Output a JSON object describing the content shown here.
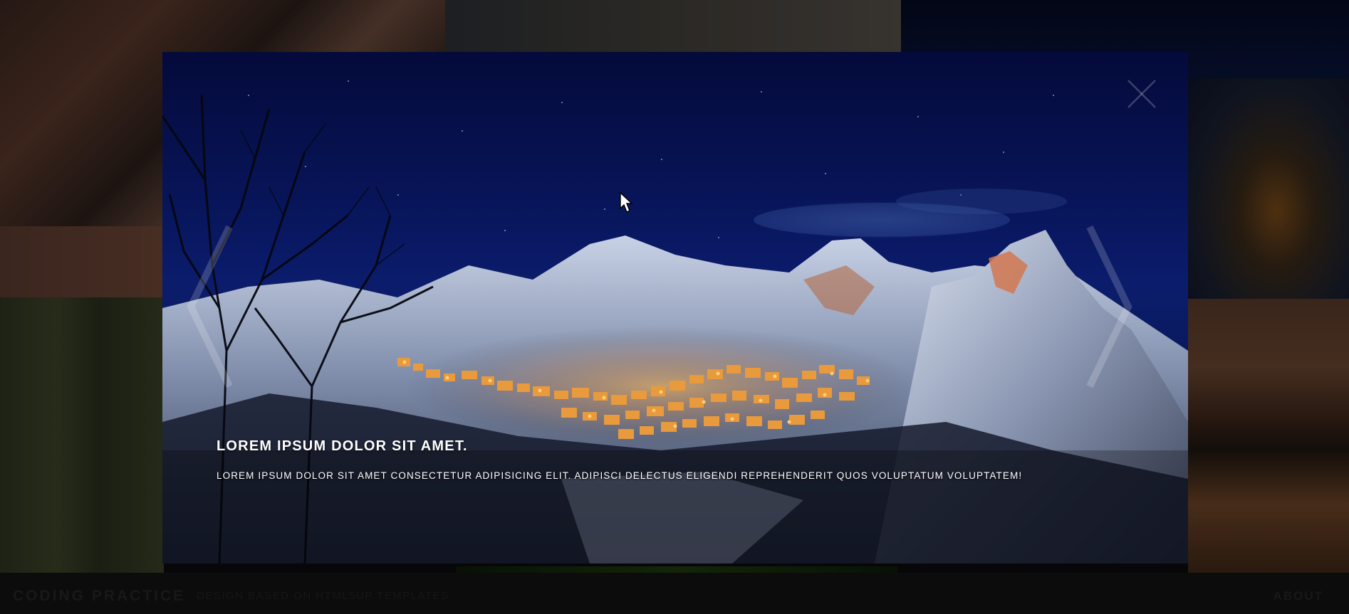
{
  "footer": {
    "brand": "CODING PRACTICE",
    "tagline": "DESIGN BASED ON HTML5UP TEMPLATES",
    "about_link": "ABOUT"
  },
  "lightbox": {
    "caption_title": "LOREM IPSUM DOLOR SIT AMET.",
    "caption_text": "LOREM IPSUM DOLOR SIT AMET CONSECTETUR ADIPISICING ELIT. ADIPISCI DELECTUS ELIGENDI REPREHENDERIT QUOS VOLUPTATUM VOLUPTATEM!",
    "close_icon": "close-icon",
    "prev_icon": "chevron-left-icon",
    "next_icon": "chevron-right-icon"
  },
  "colors": {
    "night_sky": "#08155a",
    "village_lights": "#ffb040",
    "snow": "#c8d2e6",
    "footer": "#131315"
  }
}
